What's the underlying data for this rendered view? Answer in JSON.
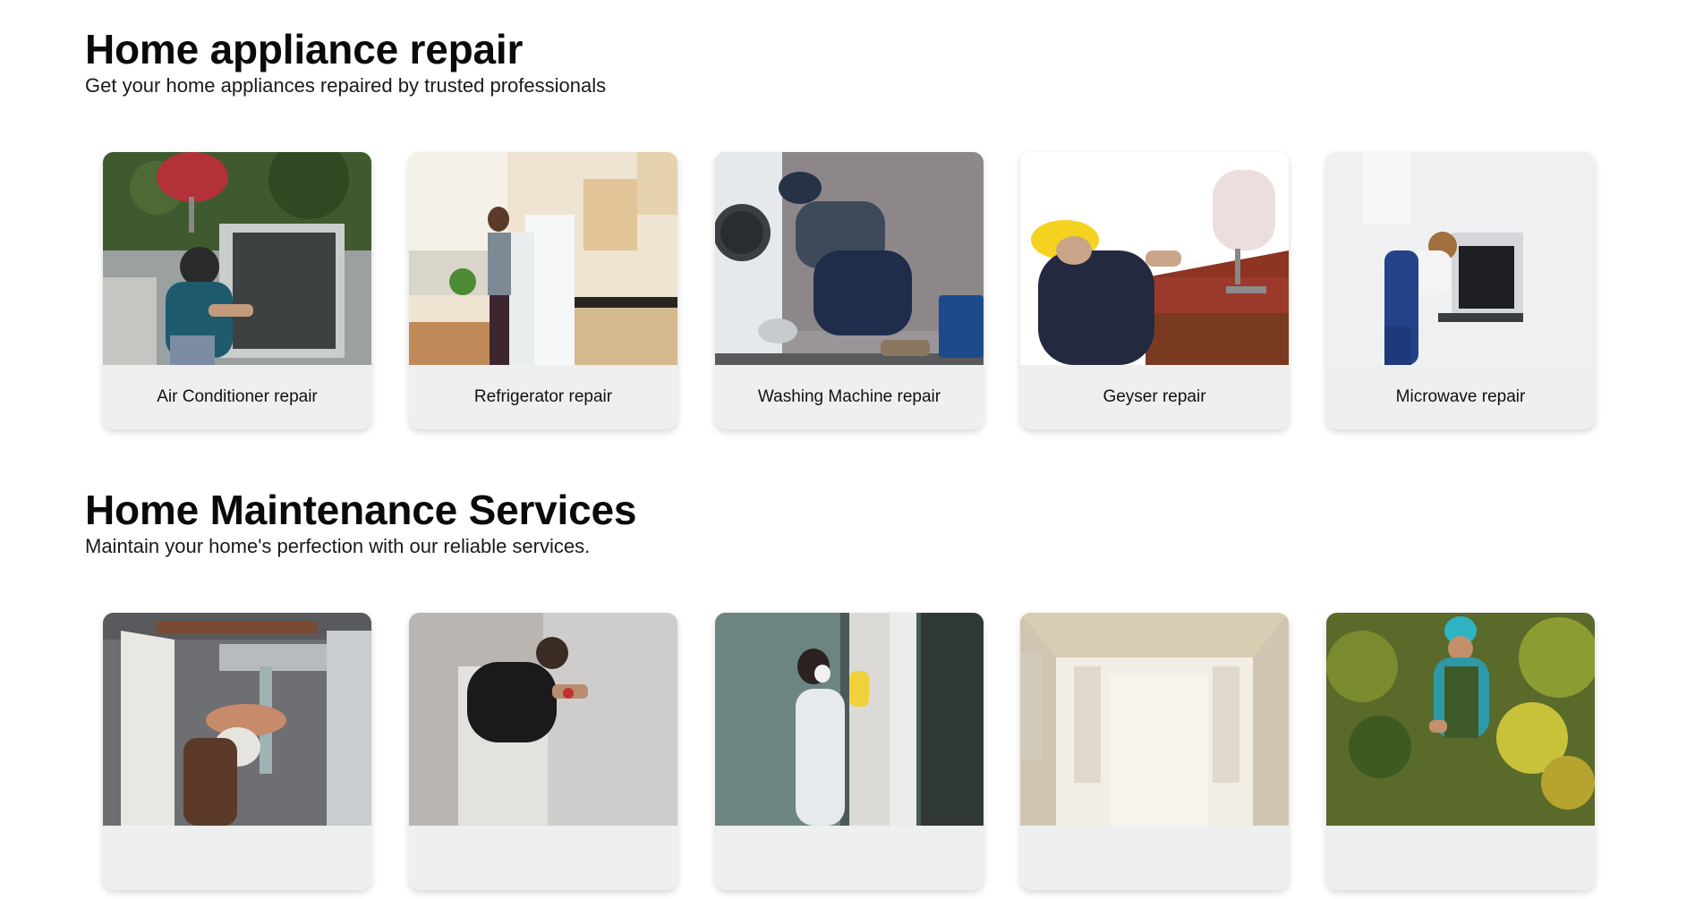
{
  "appliance_section": {
    "title": "Home appliance repair",
    "subtitle": "Get your home appliances repaired by trusted professionals",
    "cards": [
      {
        "label": "Air Conditioner repair",
        "icon": "ac-technician-photo"
      },
      {
        "label": "Refrigerator repair",
        "icon": "fridge-technician-photo"
      },
      {
        "label": "Washing Machine repair",
        "icon": "washer-technician-photo"
      },
      {
        "label": "Geyser repair",
        "icon": "geyser-technician-photo"
      },
      {
        "label": "Microwave repair",
        "icon": "microwave-technician-photo"
      }
    ]
  },
  "maintenance_section": {
    "title": "Home Maintenance Services",
    "subtitle": "Maintain your home's perfection with our reliable services.",
    "cards": [
      {
        "icon": "plumber-photo"
      },
      {
        "icon": "electrician-photo"
      },
      {
        "icon": "cleaning-photo"
      },
      {
        "icon": "empty-room-photo"
      },
      {
        "icon": "gardener-photo"
      }
    ]
  }
}
